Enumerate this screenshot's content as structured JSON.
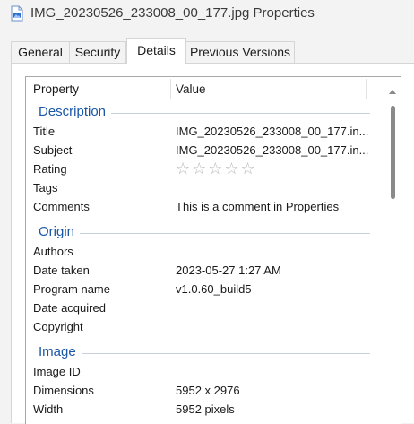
{
  "window": {
    "title": "IMG_20230526_233008_00_177.jpg Properties",
    "icon": "image-file-icon"
  },
  "tabs": [
    {
      "label": "General",
      "active": false
    },
    {
      "label": "Security",
      "active": false
    },
    {
      "label": "Details",
      "active": true
    },
    {
      "label": "Previous Versions",
      "active": false
    }
  ],
  "columns": {
    "property": "Property",
    "value": "Value"
  },
  "groups": {
    "description": "Description",
    "origin": "Origin",
    "image": "Image"
  },
  "rows": {
    "title": {
      "property": "Title",
      "value": "IMG_20230526_233008_00_177.in..."
    },
    "subject": {
      "property": "Subject",
      "value": "IMG_20230526_233008_00_177.in..."
    },
    "rating": {
      "property": "Rating",
      "stars": "☆☆☆☆☆",
      "rating_value": 0,
      "rating_max": 5
    },
    "tags": {
      "property": "Tags",
      "value": ""
    },
    "comments": {
      "property": "Comments",
      "value": "This is a comment in Properties"
    },
    "authors": {
      "property": "Authors",
      "value": ""
    },
    "date_taken": {
      "property": "Date taken",
      "value": "2023-05-27 1:27 AM"
    },
    "program_name": {
      "property": "Program name",
      "value": "v1.0.60_build5"
    },
    "date_acquired": {
      "property": "Date acquired",
      "value": ""
    },
    "copyright": {
      "property": "Copyright",
      "value": ""
    },
    "image_id": {
      "property": "Image ID",
      "value": ""
    },
    "dimensions": {
      "property": "Dimensions",
      "value": "5952 x 2976"
    },
    "width": {
      "property": "Width",
      "value": "5952 pixels"
    }
  },
  "colors": {
    "group_heading": "#1a56a6",
    "accent": "#1a56a6"
  }
}
